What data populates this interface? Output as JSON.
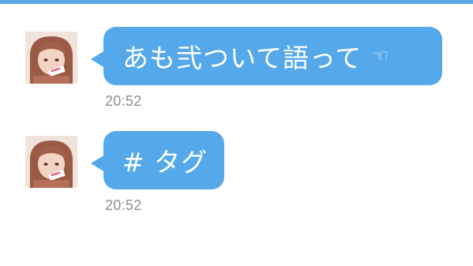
{
  "header": {
    "accent_color": "#5aa9e6"
  },
  "colors": {
    "bubble": "#55a9ea",
    "bubble_text": "#ffffff",
    "timestamp": "#8e8e93",
    "background": "#ffffff"
  },
  "messages": [
    {
      "text": "あも弐ついて語って",
      "icon": "pointing-hand-icon",
      "icon_glyph": "☜",
      "time": "20:52"
    },
    {
      "text": "# タグ",
      "time": "20:52"
    }
  ]
}
